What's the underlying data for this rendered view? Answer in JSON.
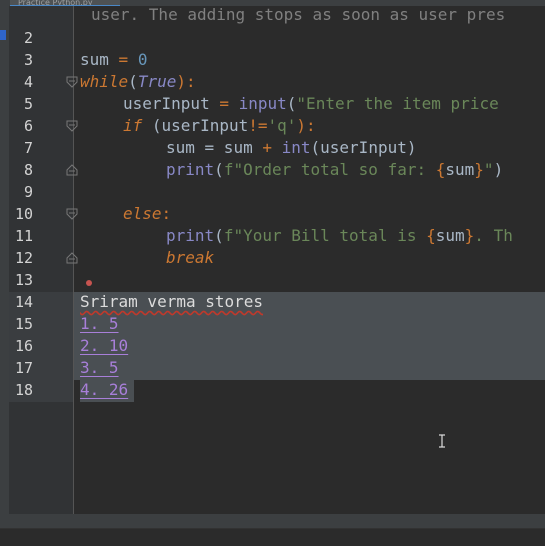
{
  "tab": {
    "label": "Practice Python.py"
  },
  "lines": [
    {
      "n": "",
      "text": "user. The adding stops as soon as user pres"
    },
    {
      "n": "2"
    },
    {
      "n": "3",
      "a": "sum",
      "b": " = ",
      "c": "0"
    },
    {
      "n": "4",
      "kw": "while",
      "p1": "(",
      "bi": "True",
      "p2": "):"
    },
    {
      "n": "5",
      "a": "userInput",
      "b": " = ",
      "fn": "input",
      "p": "(",
      "s": "\"Enter the item price"
    },
    {
      "n": "6",
      "kw": "if",
      "a": " (userInput",
      "op": "!=",
      "s": "'q'",
      "p": "):"
    },
    {
      "n": "7",
      "a": "sum",
      "b": " = sum ",
      "op": "+",
      "fn": " int",
      "p": "(userInput)"
    },
    {
      "n": "8",
      "fn": "print",
      "p": "(",
      "s1": "f\"Order total so far: ",
      "br1": "{",
      "v": "sum",
      "br2": "}",
      "s2": "\"",
      "p2": ")"
    },
    {
      "n": "9"
    },
    {
      "n": "10",
      "kw": "else",
      "p": ":"
    },
    {
      "n": "11",
      "fn": "print",
      "p": "(",
      "s1": "f\"Your Bill total is ",
      "br1": "{",
      "v": "sum",
      "br2": "}",
      "s2": ". Th"
    },
    {
      "n": "12",
      "kw": "break"
    },
    {
      "n": "13"
    },
    {
      "n": "14",
      "text": "Sriram verma stores"
    },
    {
      "n": "15",
      "text": "1. 5"
    },
    {
      "n": "16",
      "text": "2. 10"
    },
    {
      "n": "17",
      "text": "3. 5"
    },
    {
      "n": "18",
      "text": "4. 26"
    }
  ],
  "colors": {
    "background": "#2b2b2b",
    "keyword": "#cc7832",
    "string": "#6a8759",
    "number": "#6897bb",
    "builtin": "#8888c6",
    "selection": "#4a4f53",
    "list_text": "#a87fd9"
  },
  "icons": [
    "fold-open-icon",
    "fold-close-icon",
    "breakpoint-icon",
    "text-cursor-icon"
  ]
}
